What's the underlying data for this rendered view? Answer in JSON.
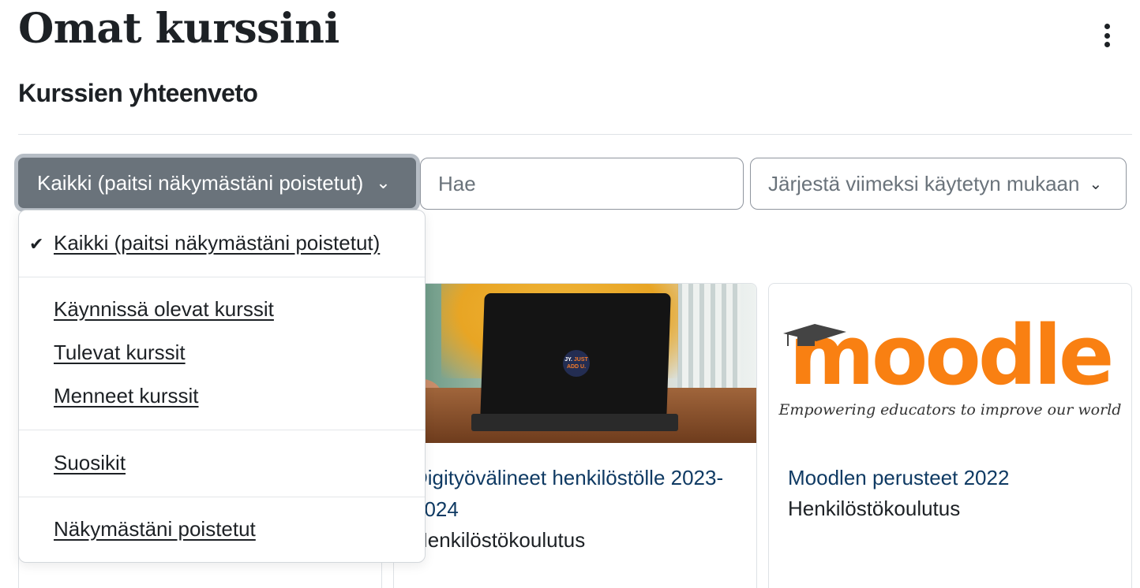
{
  "header": {
    "title": "Omat kurssini",
    "menu_icon": "kebab-vertical-icon"
  },
  "overview": {
    "title": "Kurssien yhteenveto"
  },
  "controls": {
    "filter_label": "Kaikki (paitsi näkymästäni poistetut)",
    "search_placeholder": "Hae",
    "sort_label": "Järjestä viimeksi käytetyn mukaan",
    "chevron": "⌄"
  },
  "dropdown": {
    "items": [
      {
        "label": "Kaikki (paitsi näkymästäni poistetut)",
        "selected": true
      },
      {
        "label": "Käynnissä olevat kurssit",
        "selected": false
      },
      {
        "label": "Tulevat kurssit",
        "selected": false
      },
      {
        "label": "Menneet kurssit",
        "selected": false
      },
      {
        "label": "Suosikit",
        "selected": false
      },
      {
        "label": "Näkymästäni poistetut",
        "selected": false
      }
    ],
    "check_icon": "✔"
  },
  "courses": [
    {
      "title": "",
      "category": ""
    },
    {
      "title": "Digityövälineet henkilöstölle 2023-2024",
      "category": "Henkilöstökoulutus",
      "sticker_line1": "JY.",
      "sticker_line1b": "JUST",
      "sticker_line2": "ADD U."
    },
    {
      "title": "Moodlen perusteet 2022",
      "category": "Henkilöstökoulutus",
      "logo_text": "moodle",
      "logo_tagline": "Empowering educators to improve our world"
    }
  ],
  "colors": {
    "accent_link": "#0f3a63",
    "filter_button_bg": "#6a737b",
    "moodle_orange": "#f98012"
  }
}
